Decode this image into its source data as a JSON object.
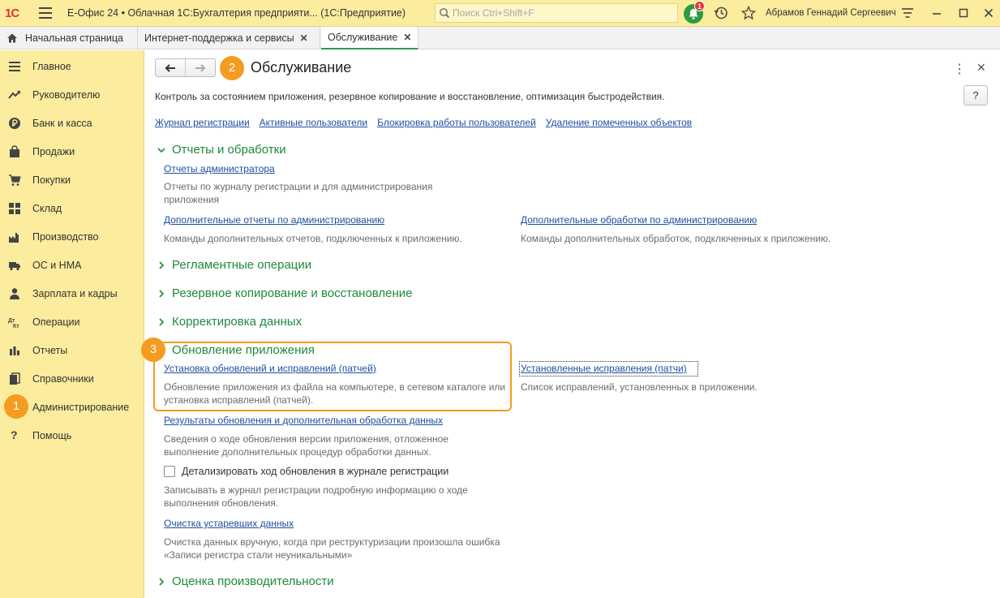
{
  "titlebar": {
    "logo": "1С",
    "title": "Е-Офис 24 • Облачная 1С:Бухгалтерия предприяти...  (1С:Предприятие)",
    "search_placeholder": "Поиск Ctrl+Shift+F",
    "notification_count": "1",
    "user": "Абрамов Геннадий Сергеевич"
  },
  "tabs": [
    {
      "label": "Начальная страница"
    },
    {
      "label": "Интернет-поддержка и сервисы",
      "close": "✕"
    },
    {
      "label": "Обслуживание",
      "close": "✕"
    }
  ],
  "sidebar": {
    "items": [
      {
        "label": "Главное"
      },
      {
        "label": "Руководителю"
      },
      {
        "label": "Банк и касса"
      },
      {
        "label": "Продажи"
      },
      {
        "label": "Покупки"
      },
      {
        "label": "Склад"
      },
      {
        "label": "Производство"
      },
      {
        "label": "ОС и НМА"
      },
      {
        "label": "Зарплата и кадры"
      },
      {
        "label": "Операции"
      },
      {
        "label": "Отчеты"
      },
      {
        "label": "Справочники"
      },
      {
        "label": "Администрирование"
      },
      {
        "label": "Помощь"
      }
    ]
  },
  "callouts": {
    "one": "1",
    "two": "2",
    "three": "3"
  },
  "page": {
    "title": "Обслуживание",
    "help": "?",
    "description": "Контроль за состоянием приложения, резервное копирование и восстановление, оптимизация быстродействия.",
    "top_links": [
      "Журнал регистрации",
      "Активные пользователи",
      "Блокировка работы пользователей",
      "Удаление помеченных объектов"
    ]
  },
  "sections": {
    "reports": {
      "title": "Отчеты и обработки",
      "admin_reports": "Отчеты администратора",
      "admin_reports_desc": "Отчеты по журналу регистрации и для администрирования приложения",
      "add_reports": "Дополнительные отчеты по администрированию",
      "add_reports_desc": "Команды дополнительных отчетов, подключенных к приложению.",
      "add_processing": "Дополнительные обработки по администрированию",
      "add_processing_desc": "Команды дополнительных обработок, подключенных к приложению."
    },
    "regular": {
      "title": "Регламентные операции"
    },
    "backup": {
      "title": "Резервное копирование и восстановление"
    },
    "correction": {
      "title": "Корректировка данных"
    },
    "update": {
      "title": "Обновление приложения",
      "install_link": "Установка обновлений и исправлений (патчей)",
      "install_desc": "Обновление приложения из файла на компьютере, в сетевом каталоге или установка исправлений (патчей).",
      "installed_link": "Установленные исправления (патчи)",
      "installed_desc": "Список исправлений, установленных в приложении.",
      "results_link": "Результаты обновления и дополнительная обработка данных",
      "results_desc": "Сведения о ходе обновления версии приложения, отложенное выполнение дополнительных процедур обработки данных.",
      "detail_checkbox": "Детализировать ход обновления в журнале регистрации",
      "detail_checked": false,
      "detail_desc": "Записывать в журнал регистрации подробную информацию о ходе выполнения обновления.",
      "cleanup_link": "Очистка устаревших данных",
      "cleanup_desc": "Очистка данных вручную, когда при реструктуризации произошла ошибка «Записи регистра стали неуникальными»"
    },
    "performance": {
      "title": "Оценка производительности"
    }
  },
  "colors": {
    "accent_green": "#1e8a3c",
    "link_blue": "#1f4fa0",
    "callout_orange": "#f39c1f",
    "sidebar_yellow": "#fbec9e"
  }
}
